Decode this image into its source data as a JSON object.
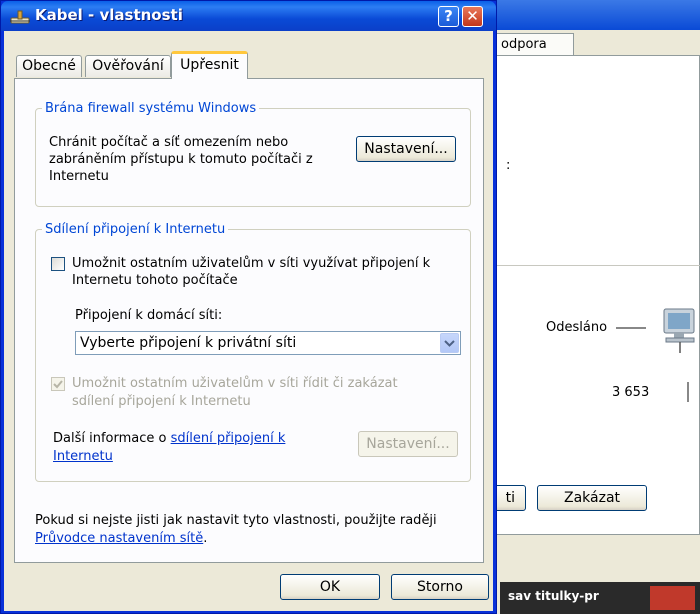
{
  "dialog": {
    "title": "Kabel - vlastnosti",
    "help_glyph": "?",
    "close_glyph": "✕",
    "tabs": [
      {
        "label": "Obecné"
      },
      {
        "label": "Ověřování"
      },
      {
        "label": "Upřesnit",
        "selected": true
      }
    ],
    "firewall": {
      "legend": "Brána firewall systému Windows",
      "description": "Chránit počítač a síť omezením nebo zabráněním přístupu k tomuto počítači z Internetu",
      "settings_button": "Nastavení..."
    },
    "ics": {
      "legend": "Sdílení připojení k Internetu",
      "share_checkbox_label": "Umožnit ostatním uživatelům v síti využívat připojení k Internetu tohoto počítače",
      "share_checked": false,
      "home_network_label": "Připojení k domácí síti:",
      "home_network_value": "Vyberte připojení k privátní síti",
      "control_checkbox_label": "Umožnit ostatním uživatelům v síti řídit či zakázat sdílení připojení k Internetu",
      "control_checked": true,
      "more_info_prefix": "Další informace o ",
      "more_info_link": "sdílení připojení k Internetu",
      "settings_button": "Nastavení..."
    },
    "footer": {
      "text": "Pokud si nejste jisti jak nastavit tyto vlastnosti, použijte raději ",
      "link": "Průvodce nastavením sítě",
      "suffix": "."
    },
    "ok_button": "OK",
    "cancel_button": "Storno"
  },
  "background_window": {
    "tab_label": "odpora",
    "colon": ":",
    "sent_label": "Odesláno",
    "sent_count": "3 653",
    "left_button_label": "ti",
    "disable_button": "Zakázat",
    "taskbar_text": "sav titulky-pr"
  },
  "colors": {
    "titlebar": "#0a4ad6",
    "legend": "#0046d5",
    "link": "#0033cc",
    "disabled_text": "#a7a69b",
    "tab_accent": "#ffc73c"
  }
}
